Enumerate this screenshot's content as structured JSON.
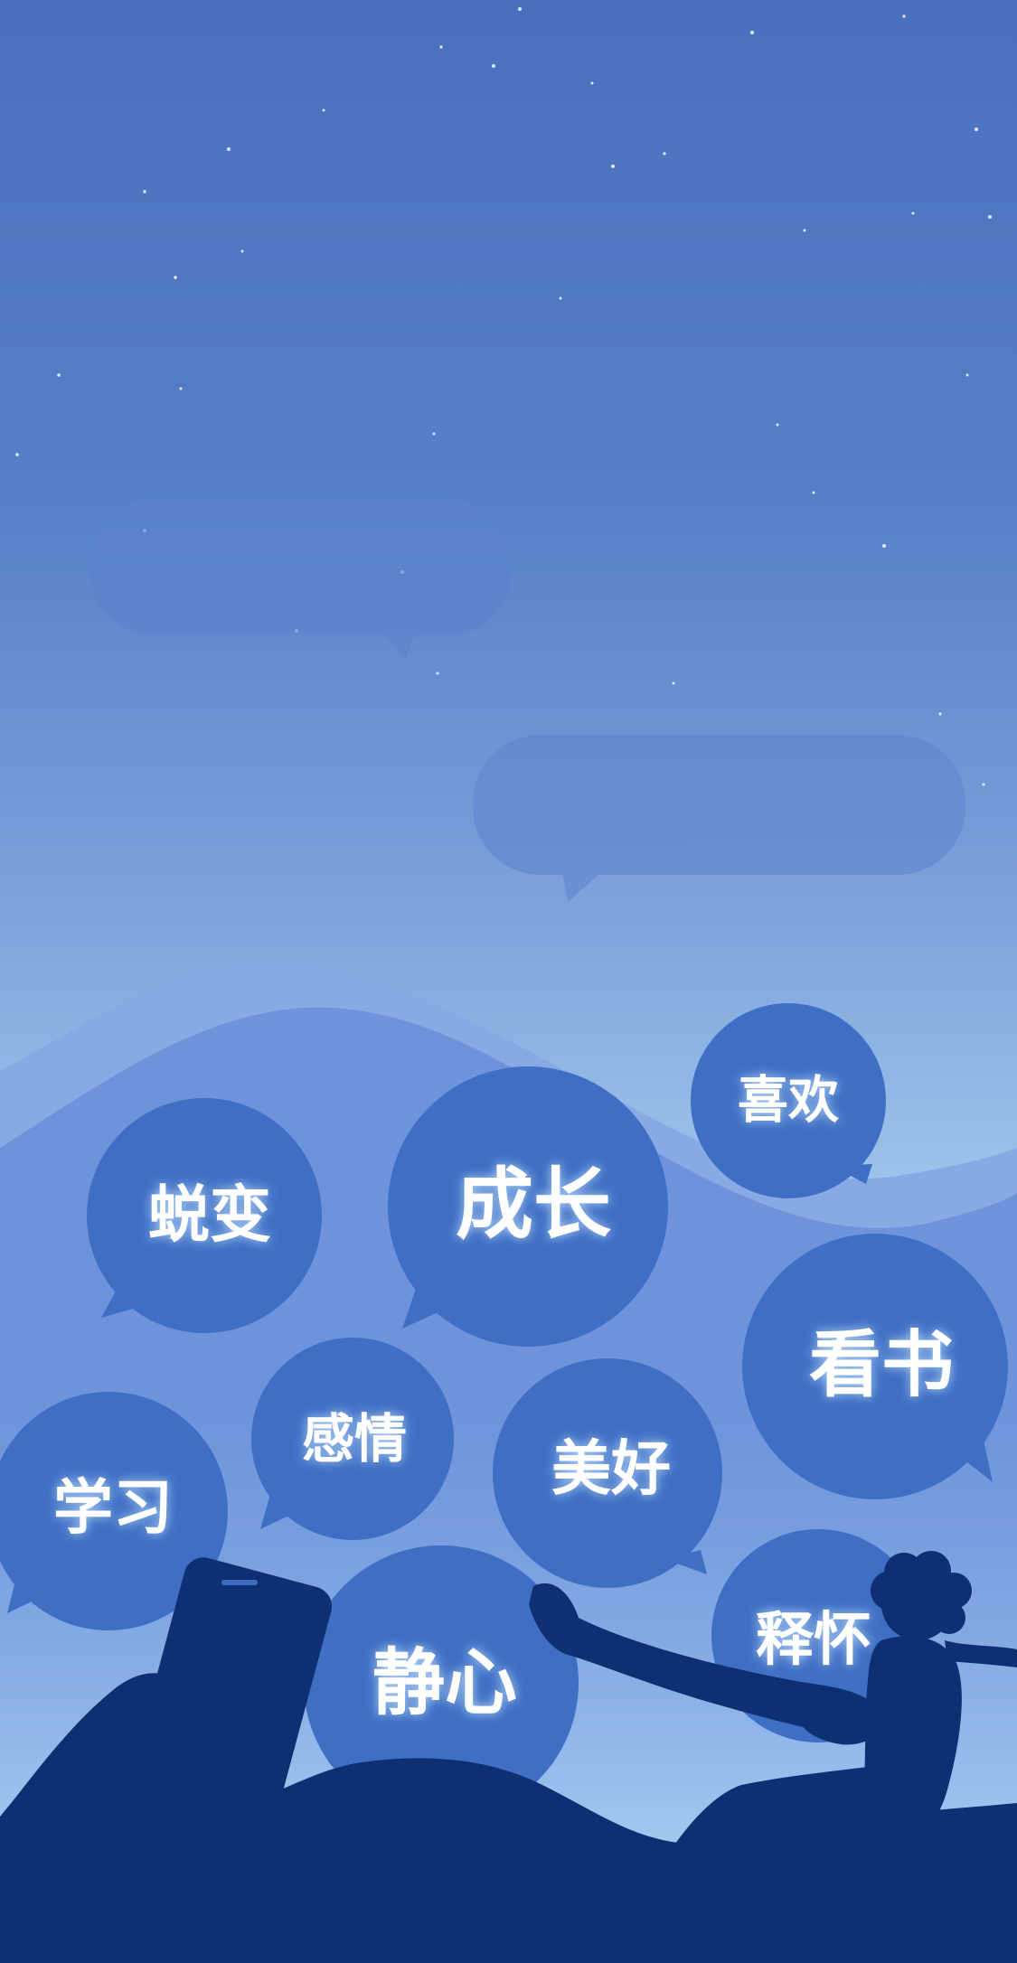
{
  "colors": {
    "sky_top": "#4a72bf",
    "sky_mid": "#7fa3dc",
    "sky_bottom": "#b9dcf2",
    "hill_far": "#86a8e3",
    "hill_mid": "#6f94dc",
    "bubble": "#3f6fc4",
    "silhouette": "#0e2f72",
    "ghost_bubble": "#5f86cf"
  },
  "bubbles": [
    {
      "id": "xihuan",
      "label": "喜欢"
    },
    {
      "id": "tuibian",
      "label": "蜕变"
    },
    {
      "id": "chengzhang",
      "label": "成长"
    },
    {
      "id": "kanshu",
      "label": "看书"
    },
    {
      "id": "ganqing",
      "label": "感情"
    },
    {
      "id": "meihao",
      "label": "美好"
    },
    {
      "id": "xuexi",
      "label": "学习"
    },
    {
      "id": "jingxin",
      "label": "静心"
    },
    {
      "id": "shihuai",
      "label": "释怀"
    }
  ],
  "icons": {
    "phone": "phone-silhouette-icon",
    "person": "sitting-person-silhouette-icon"
  }
}
